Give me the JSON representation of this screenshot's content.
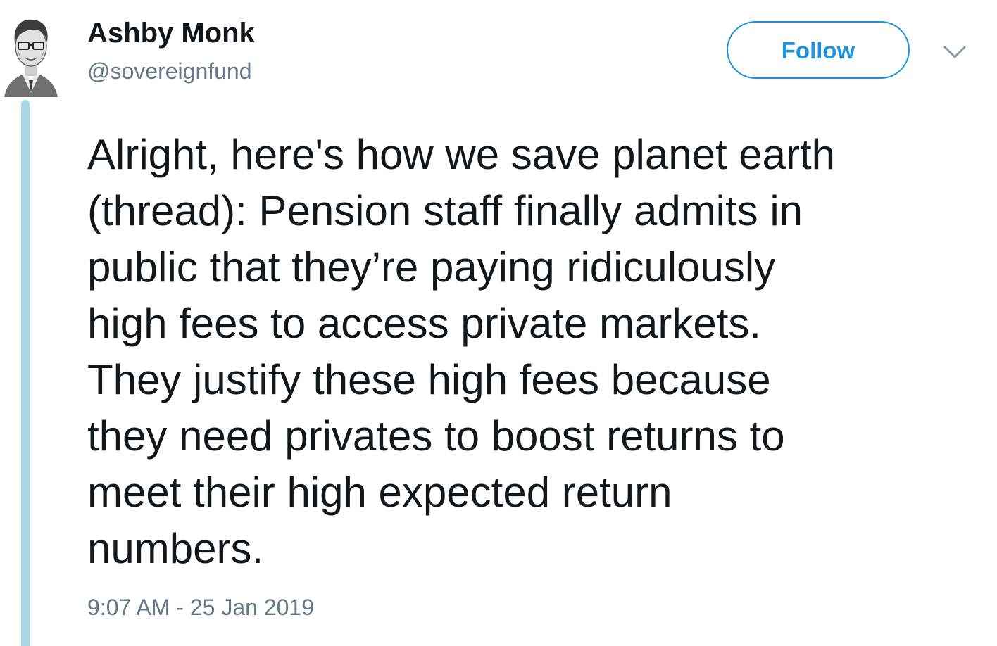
{
  "author": {
    "display_name": "Ashby Monk",
    "handle": "@sovereignfund"
  },
  "actions": {
    "follow_label": "Follow",
    "menu_icon": "chevron-down-icon"
  },
  "tweet": {
    "lines": [
      "Alright, here's how we save planet earth",
      "(thread): Pension staff finally admits in",
      "public that they’re paying ridiculously",
      "high fees to access private markets.",
      "They justify these high fees because",
      "they need privates to boost returns to",
      "meet their high expected return",
      "numbers."
    ],
    "timestamp": "9:07 AM - 25 Jan 2019"
  },
  "colors": {
    "accent": "#1b95e0",
    "thread_line": "#a8d5e5",
    "secondary_text": "#657786",
    "primary_text": "#14171a"
  }
}
